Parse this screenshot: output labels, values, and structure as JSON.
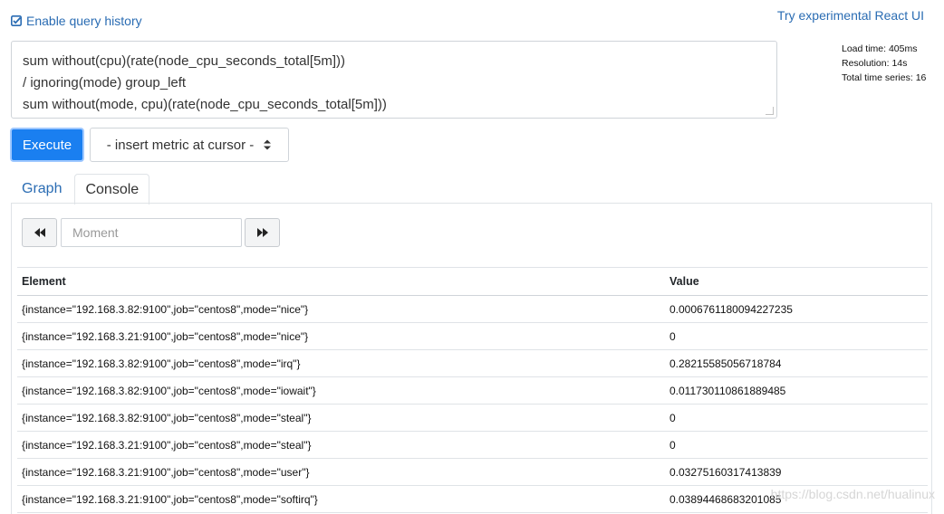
{
  "header": {
    "history_label": "Enable query history",
    "react_link": "Try experimental React UI"
  },
  "query": {
    "lines": [
      "sum without(cpu)(rate(node_cpu_seconds_total[5m]))",
      "/ ignoring(mode) group_left",
      "sum without(mode, cpu)(rate(node_cpu_seconds_total[5m]))"
    ]
  },
  "stats": {
    "load_time": "Load time: 405ms",
    "resolution": "Resolution: 14s",
    "total_series": "Total time series: 16"
  },
  "controls": {
    "execute_label": "Execute",
    "metric_select_label": "- insert metric at cursor -"
  },
  "tabs": [
    {
      "label": "Graph"
    },
    {
      "label": "Console"
    }
  ],
  "console": {
    "moment_placeholder": "Moment",
    "columns": [
      "Element",
      "Value"
    ],
    "rows": [
      {
        "element": "{instance=\"192.168.3.82:9100\",job=\"centos8\",mode=\"nice\"}",
        "value": "0.0006761180094227235"
      },
      {
        "element": "{instance=\"192.168.3.21:9100\",job=\"centos8\",mode=\"nice\"}",
        "value": "0"
      },
      {
        "element": "{instance=\"192.168.3.82:9100\",job=\"centos8\",mode=\"irq\"}",
        "value": "0.28215585056718784"
      },
      {
        "element": "{instance=\"192.168.3.82:9100\",job=\"centos8\",mode=\"iowait\"}",
        "value": "0.011730110861889485"
      },
      {
        "element": "{instance=\"192.168.3.82:9100\",job=\"centos8\",mode=\"steal\"}",
        "value": "0"
      },
      {
        "element": "{instance=\"192.168.3.21:9100\",job=\"centos8\",mode=\"steal\"}",
        "value": "0"
      },
      {
        "element": "{instance=\"192.168.3.21:9100\",job=\"centos8\",mode=\"user\"}",
        "value": "0.03275160317413839"
      },
      {
        "element": "{instance=\"192.168.3.21:9100\",job=\"centos8\",mode=\"softirq\"}",
        "value": "0.03894468683201085"
      }
    ]
  },
  "watermark": "https://blog.csdn.net/hualinux",
  "colors": {
    "accent": "#1a7ff0",
    "link": "#2a6cb3"
  }
}
